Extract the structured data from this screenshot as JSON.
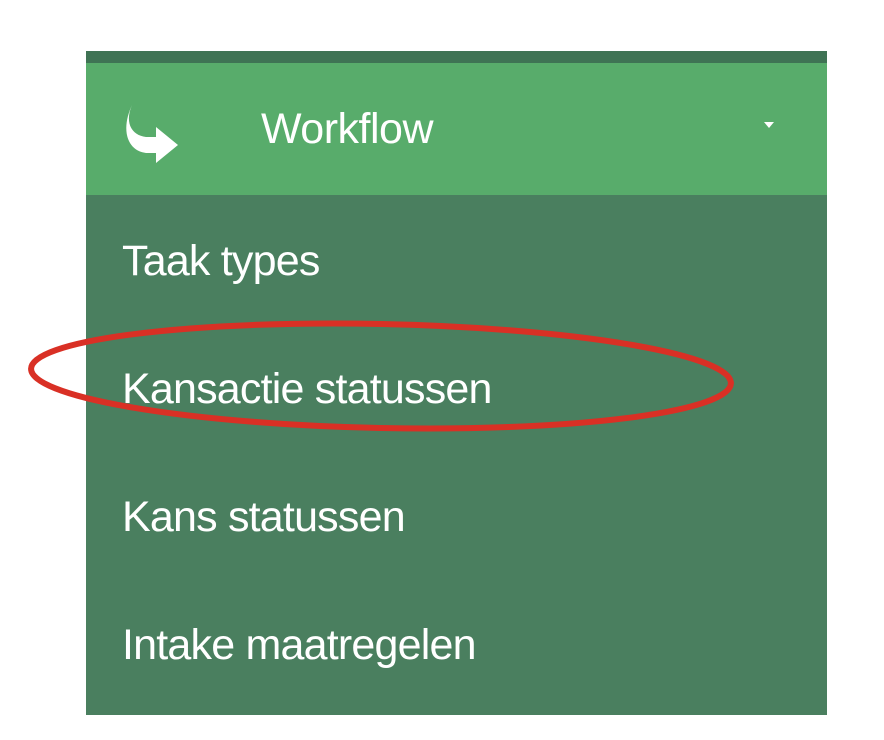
{
  "menu": {
    "header": {
      "label": "Workflow",
      "icon": "curved-arrow-icon",
      "chevron": "chevron-down-icon",
      "expanded": true
    },
    "items": [
      {
        "label": "Taak types"
      },
      {
        "label": "Kansactie statussen",
        "highlighted": true
      },
      {
        "label": "Kans statussen"
      },
      {
        "label": "Intake maatregelen"
      }
    ]
  },
  "colors": {
    "header_bg": "#58ac6b",
    "submenu_bg": "#4a7f5f",
    "text": "#ffffff",
    "highlight_ellipse": "#d93025"
  }
}
